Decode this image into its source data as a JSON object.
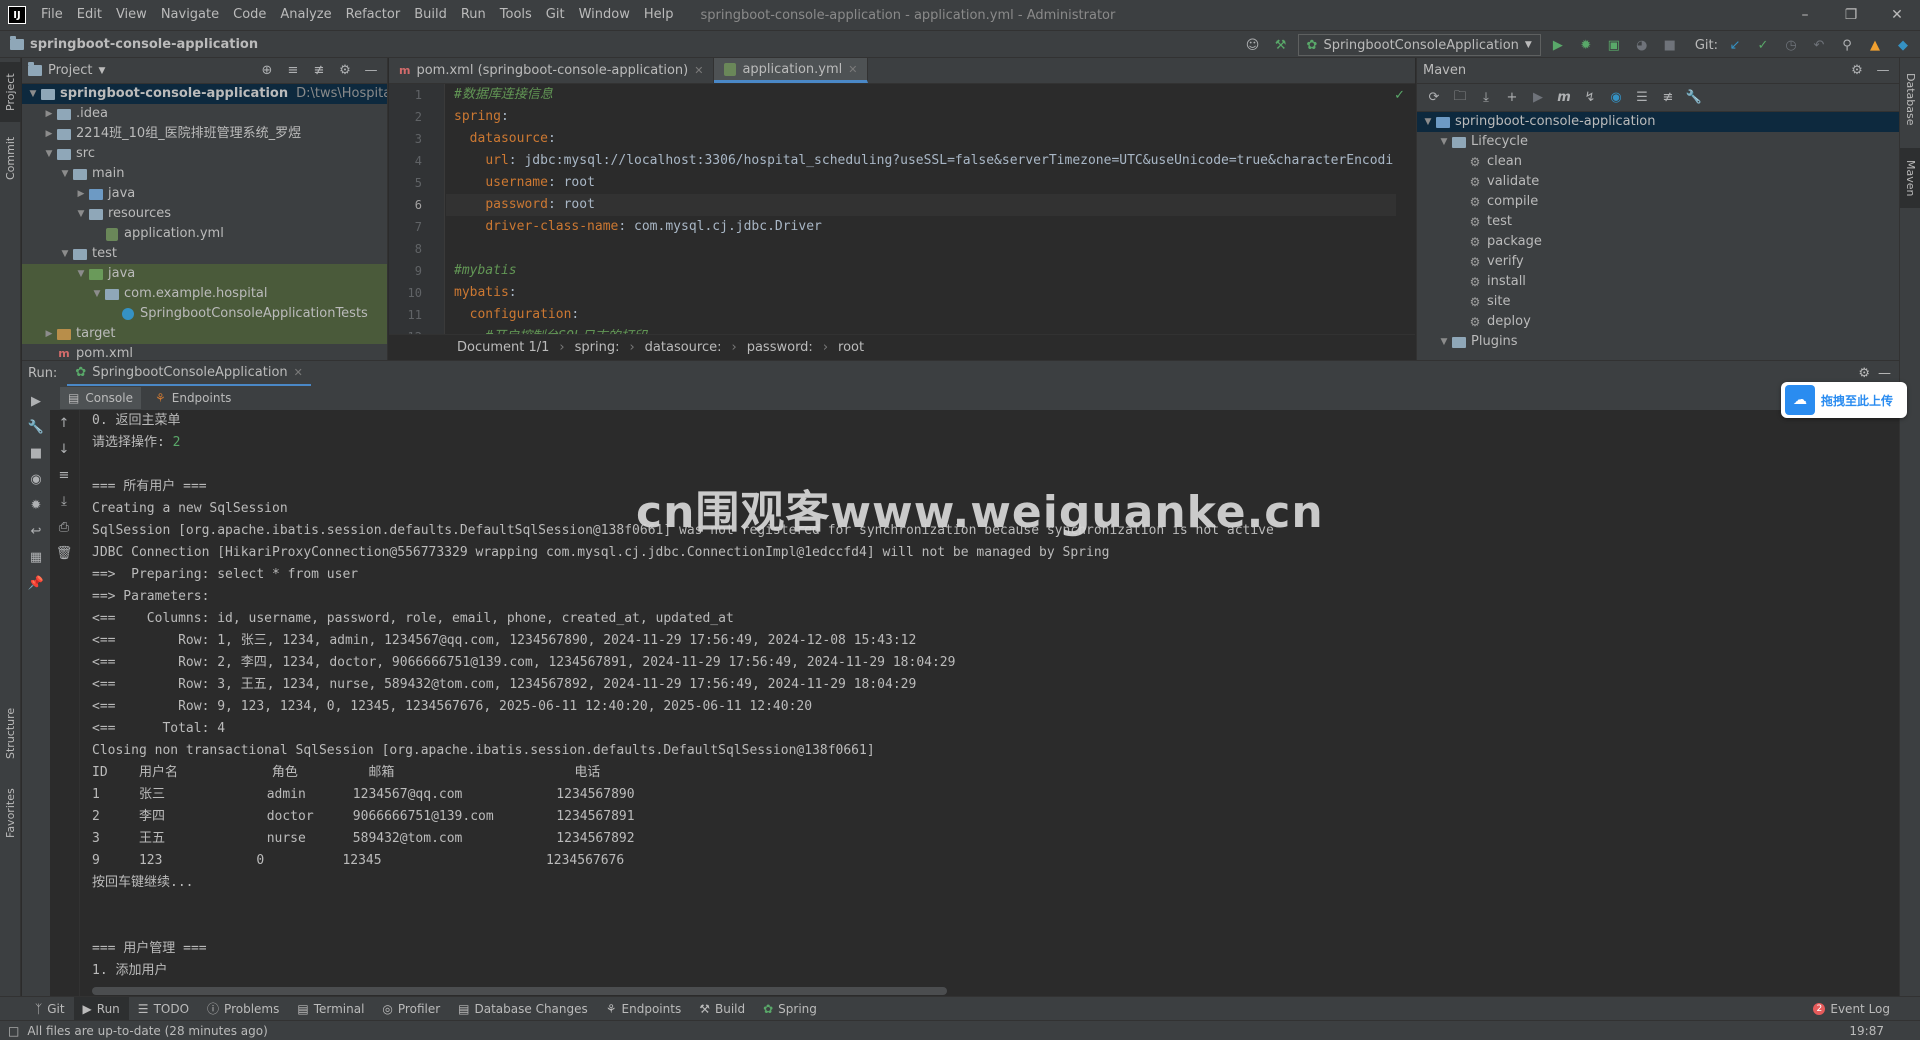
{
  "titlebar": {
    "menu": [
      "File",
      "Edit",
      "View",
      "Navigate",
      "Code",
      "Analyze",
      "Refactor",
      "Build",
      "Run",
      "Tools",
      "Git",
      "Window",
      "Help"
    ],
    "window_title": "springboot-console-application - application.yml - Administrator"
  },
  "navbar": {
    "project": "springboot-console-application",
    "run_config": "SpringbootConsoleApplication",
    "git_label": "Git:"
  },
  "left_strip": {
    "project": "Project",
    "commit": "Commit",
    "structure": "Structure",
    "favorites": "Favorites"
  },
  "right_strip": {
    "database": "Database",
    "maven": "Maven"
  },
  "project_panel": {
    "title": "Project",
    "tree": [
      {
        "label": "springboot-console-application",
        "hint": "D:\\tws\\HospitalSched",
        "indent": 0,
        "arrow": "▼",
        "icon": "folder-gray",
        "selected": true
      },
      {
        "label": ".idea",
        "indent": 1,
        "arrow": "▶",
        "icon": "folder-gray"
      },
      {
        "label": "2214班_10组_医院排班管理系统_罗煜",
        "indent": 1,
        "arrow": "▶",
        "icon": "folder-gray"
      },
      {
        "label": "src",
        "indent": 1,
        "arrow": "▼",
        "icon": "folder-gray"
      },
      {
        "label": "main",
        "indent": 2,
        "arrow": "▼",
        "icon": "folder-gray"
      },
      {
        "label": "java",
        "indent": 3,
        "arrow": "▶",
        "icon": "folder-blue"
      },
      {
        "label": "resources",
        "indent": 3,
        "arrow": "▼",
        "icon": "folder-gray"
      },
      {
        "label": "application.yml",
        "indent": 4,
        "arrow": "",
        "icon": "file-yml"
      },
      {
        "label": "test",
        "indent": 2,
        "arrow": "▼",
        "icon": "folder-gray"
      },
      {
        "label": "java",
        "indent": 3,
        "arrow": "▼",
        "icon": "folder-green",
        "highlight": true
      },
      {
        "label": "com.example.hospital",
        "indent": 4,
        "arrow": "▼",
        "icon": "folder-gray",
        "highlight": true
      },
      {
        "label": "SpringbootConsoleApplicationTests",
        "indent": 5,
        "arrow": "",
        "icon": "file-test",
        "highlight": true
      },
      {
        "label": "target",
        "indent": 1,
        "arrow": "▶",
        "icon": "folder-orange",
        "highlight": true
      },
      {
        "label": "pom.xml",
        "indent": 1,
        "arrow": "",
        "icon": "file-xml"
      }
    ]
  },
  "editor": {
    "tabs": [
      {
        "label": "pom.xml (springboot-console-application)",
        "active": false
      },
      {
        "label": "application.yml",
        "active": true
      }
    ],
    "lines": [
      {
        "n": "1",
        "html": "<span class='c'>#数据库连接信息</span>"
      },
      {
        "n": "2",
        "html": "<span class='k'>spring</span>:"
      },
      {
        "n": "3",
        "html": "  <span class='k'>datasource</span>:"
      },
      {
        "n": "4",
        "html": "    <span class='k'>url</span>: jdbc:mysql://localhost:3306/hospital_scheduling?useSSL=false&serverTimezone=UTC&useUnicode=true&characterEncodi"
      },
      {
        "n": "5",
        "html": "    <span class='k'>username</span>: root"
      },
      {
        "n": "6",
        "html": "    <span class='k'>password</span>: root",
        "cur": true
      },
      {
        "n": "7",
        "html": "    <span class='k'>driver-class-name</span>: com.mysql.cj.jdbc.Driver"
      },
      {
        "n": "8",
        "html": ""
      },
      {
        "n": "9",
        "html": "<span class='c'>#mybatis</span>"
      },
      {
        "n": "10",
        "html": "<span class='k'>mybatis</span>:"
      },
      {
        "n": "11",
        "html": "  <span class='k'>configuration</span>:"
      },
      {
        "n": "12",
        "html": "    <span class='c'>#开启控制台SQL日志的打印</span>"
      }
    ],
    "breadcrumb": [
      "Document 1/1",
      "spring:",
      "datasource:",
      "password:",
      "root"
    ]
  },
  "maven": {
    "title": "Maven",
    "root": "springboot-console-application",
    "lifecycle_label": "Lifecycle",
    "goals": [
      "clean",
      "validate",
      "compile",
      "test",
      "package",
      "verify",
      "install",
      "site",
      "deploy"
    ],
    "plugins_label": "Plugins"
  },
  "run": {
    "label": "Run:",
    "tab": "SpringbootConsoleApplication",
    "subtabs": [
      "Console",
      "Endpoints"
    ],
    "console": [
      {
        "text": "0. 返回主菜单"
      },
      {
        "text": "请选择操作: ",
        "input": "2"
      },
      {
        "text": ""
      },
      {
        "text": "=== 所有用户 ==="
      },
      {
        "text": "Creating a new SqlSession"
      },
      {
        "text": "SqlSession [org.apache.ibatis.session.defaults.DefaultSqlSession@138f0661] was not registered for synchronization because synchronization is not active"
      },
      {
        "text": "JDBC Connection [HikariProxyConnection@556773329 wrapping com.mysql.cj.jdbc.ConnectionImpl@1edccfd4] will not be managed by Spring"
      },
      {
        "text": "==>  Preparing: select * from user"
      },
      {
        "text": "==> Parameters: "
      },
      {
        "text": "<==    Columns: id, username, password, role, email, phone, created_at, updated_at"
      },
      {
        "text": "<==        Row: 1, 张三, 1234, admin, 1234567@qq.com, 1234567890, 2024-11-29 17:56:49, 2024-12-08 15:43:12"
      },
      {
        "text": "<==        Row: 2, 李四, 1234, doctor, 9066666751@139.com, 1234567891, 2024-11-29 17:56:49, 2024-11-29 18:04:29"
      },
      {
        "text": "<==        Row: 3, 王五, 1234, nurse, 589432@tom.com, 1234567892, 2024-11-29 17:56:49, 2024-11-29 18:04:29"
      },
      {
        "text": "<==        Row: 9, 123, 1234, 0, 12345, 1234567676, 2025-06-11 12:40:20, 2025-06-11 12:40:20"
      },
      {
        "text": "<==      Total: 4"
      },
      {
        "text": "Closing non transactional SqlSession [org.apache.ibatis.session.defaults.DefaultSqlSession@138f0661]"
      },
      {
        "text": "ID    用户名            角色         邮箱                       电话"
      },
      {
        "text": "1     张三             admin      1234567@qq.com            1234567890"
      },
      {
        "text": "2     李四             doctor     9066666751@139.com        1234567891"
      },
      {
        "text": "3     王五             nurse      589432@tom.com            1234567892"
      },
      {
        "text": "9     123            0          12345                     1234567676"
      },
      {
        "text": "按回车键继续..."
      },
      {
        "text": ""
      },
      {
        "text": ""
      },
      {
        "text": "=== 用户管理 ==="
      },
      {
        "text": "1. 添加用户"
      }
    ]
  },
  "upload_badge": "拖拽至此上传",
  "watermark": "cn围观客www.weiguanke.cn",
  "bottom_tools": [
    "Git",
    "Run",
    "TODO",
    "Problems",
    "Terminal",
    "Profiler",
    "Database Changes",
    "Endpoints",
    "Build",
    "Spring"
  ],
  "event_log": {
    "count": "2",
    "label": "Event Log"
  },
  "status": {
    "message": "All files are up-to-date (28 minutes ago)",
    "time": "19:87"
  },
  "colors": {
    "accent": "#4a88c7",
    "run_green": "#59a869",
    "keyword": "#cc7832",
    "comment": "#629755"
  }
}
